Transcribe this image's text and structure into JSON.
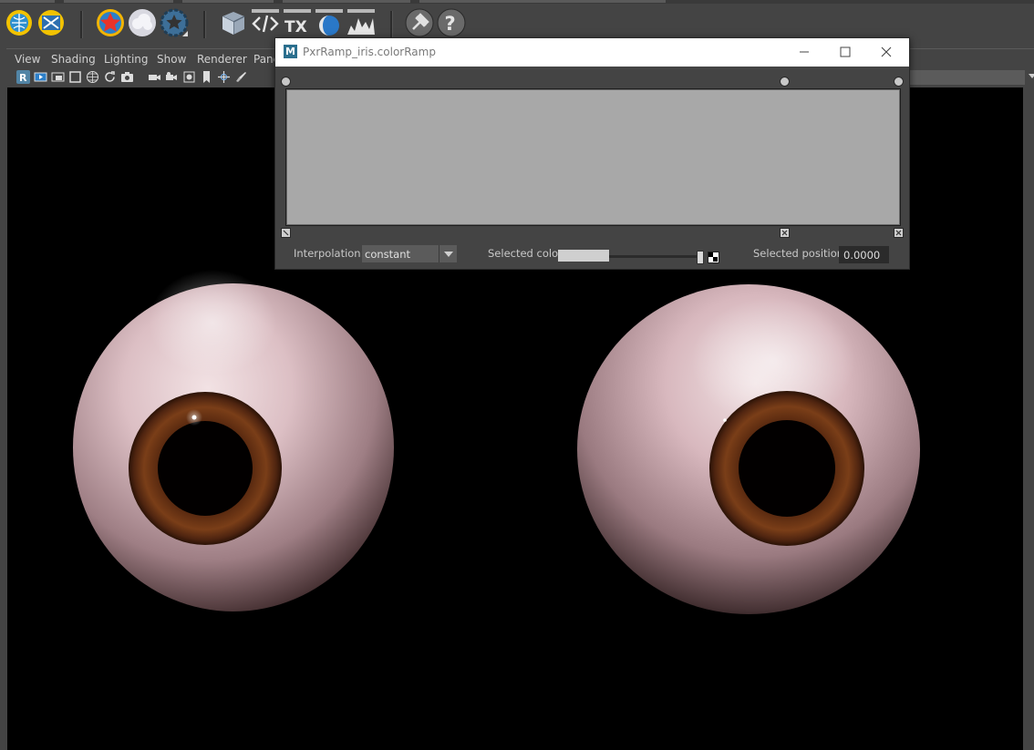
{
  "viewport_menu": [
    "View",
    "Shading",
    "Lighting",
    "Show",
    "Renderer",
    "Pane"
  ],
  "shelf_icons": [
    "render-globe-icon",
    "render-view-icon",
    "renderman-star-icon",
    "cloud-icon",
    "gear-star-icon",
    "package-icon",
    "code-icon",
    "tx-icon",
    "preview-icon",
    "waveform-icon",
    "plugin-icon",
    "help-icon"
  ],
  "shelf_tx_label": "TX",
  "viewport_tools": [
    "renderman-icon",
    "ipr-icon",
    "render-region-icon",
    "frame-icon",
    "grid-icon",
    "refresh-icon",
    "snapshot-icon",
    "camera-icon",
    "camera-select-icon",
    "film-icon",
    "bookmark-icon",
    "transform-icon",
    "brush-icon"
  ],
  "ramp_window": {
    "title": "PxrRamp_iris.colorRamp",
    "interpolation_label": "Interpolation:",
    "interpolation_value": "constant",
    "selected_color_label": "Selected color:",
    "selected_position_label": "Selected position:",
    "selected_position_value": "0.0000",
    "ramp_color": "#a8a8a8",
    "handles": [
      0.0,
      0.813,
      1.0
    ]
  },
  "colors": {
    "background": "#444444",
    "viewport": "#000000",
    "accent": "#5285a6",
    "iris": "#6b3a1a",
    "sclera": "#e8d0d4"
  }
}
